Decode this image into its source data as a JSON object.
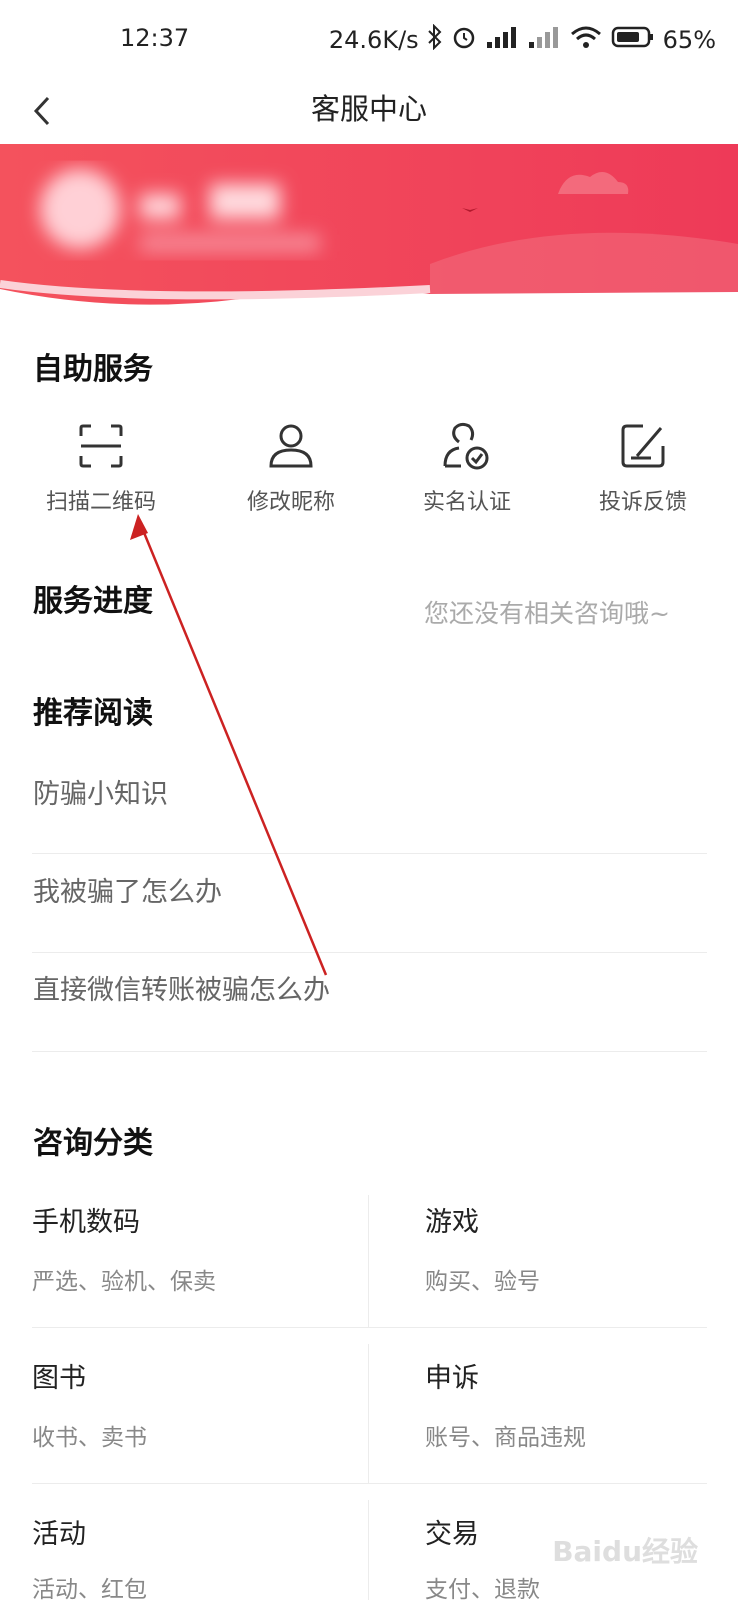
{
  "status_bar": {
    "time": "12:37",
    "speed": "24.6K/s",
    "battery": "65%"
  },
  "nav": {
    "title": "客服中心"
  },
  "self_service": {
    "title": "自助服务",
    "items": [
      {
        "label": "扫描二维码",
        "icon": "scan-icon"
      },
      {
        "label": "修改昵称",
        "icon": "user-icon"
      },
      {
        "label": "实名认证",
        "icon": "verified-user-icon"
      },
      {
        "label": "投诉反馈",
        "icon": "edit-icon"
      }
    ]
  },
  "progress": {
    "title": "服务进度",
    "hint": "您还没有相关咨询哦~"
  },
  "recommended": {
    "title": "推荐阅读",
    "items": [
      "防骗小知识",
      "我被骗了怎么办",
      "直接微信转账被骗怎么办"
    ]
  },
  "categories": {
    "title": "咨询分类",
    "items": [
      {
        "title": "手机数码",
        "sub": "严选、验机、保卖"
      },
      {
        "title": "游戏",
        "sub": "购买、验号"
      },
      {
        "title": "图书",
        "sub": "收书、卖书"
      },
      {
        "title": "申诉",
        "sub": "账号、商品违规"
      },
      {
        "title": "活动",
        "sub": "活动、红包"
      },
      {
        "title": "交易",
        "sub": "支付、退款"
      }
    ]
  },
  "watermark": "Baidu经验",
  "colors": {
    "banner": "#f0415a",
    "accent_arrow": "#cc2222"
  }
}
